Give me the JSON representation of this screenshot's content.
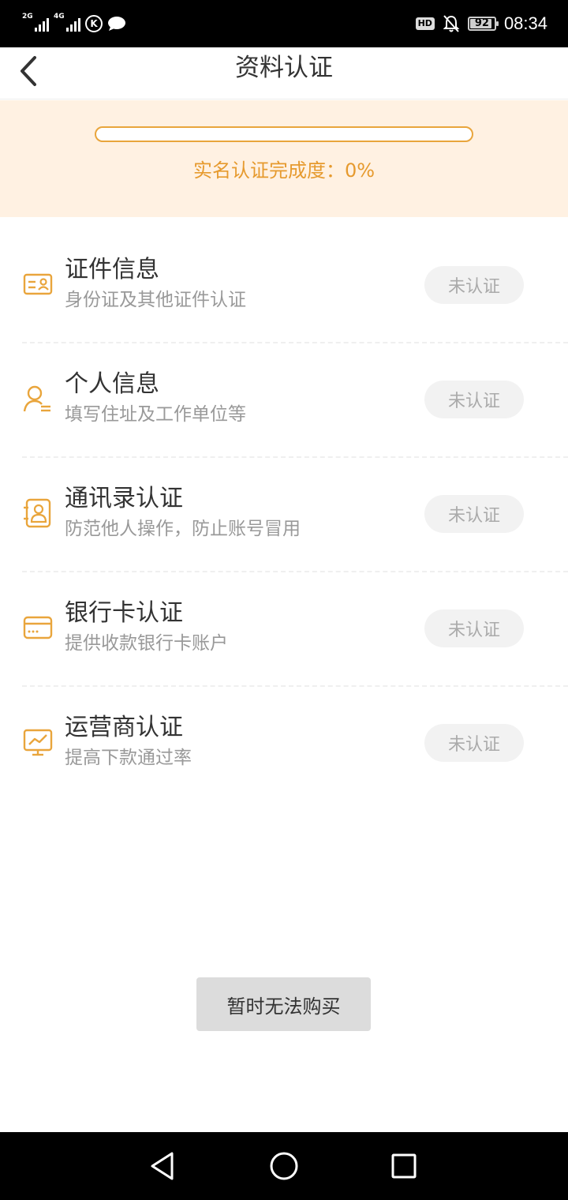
{
  "status_bar": {
    "signal_1_label": "2G",
    "signal_2_label": "4G",
    "k_icon_label": "K",
    "hd_label": "HD",
    "battery_level": "92",
    "battery_fraction": 0.92,
    "time": "08:34"
  },
  "header": {
    "title": "资料认证"
  },
  "progress": {
    "label": "实名认证完成度：0%",
    "fraction": 0,
    "accent_color": "#e9a53c",
    "panel_color": "#fff1e2"
  },
  "items": [
    {
      "icon": "id-card-icon",
      "title": "证件信息",
      "subtitle": "身份证及其他证件认证",
      "status": "未认证"
    },
    {
      "icon": "person-info-icon",
      "title": "个人信息",
      "subtitle": "填写住址及工作单位等",
      "status": "未认证"
    },
    {
      "icon": "contacts-book-icon",
      "title": "通讯录认证",
      "subtitle": "防范他人操作，防止账号冒用",
      "status": "未认证"
    },
    {
      "icon": "bank-card-icon",
      "title": "银行卡认证",
      "subtitle": "提供收款银行卡账户",
      "status": "未认证"
    },
    {
      "icon": "carrier-monitor-icon",
      "title": "运营商认证",
      "subtitle": "提高下款通过率",
      "status": "未认证"
    }
  ],
  "bottom_button": {
    "label": "暂时无法购买"
  },
  "nav": {
    "back": "triangle-back-icon",
    "home": "circle-home-icon",
    "recent": "square-recent-icon"
  }
}
